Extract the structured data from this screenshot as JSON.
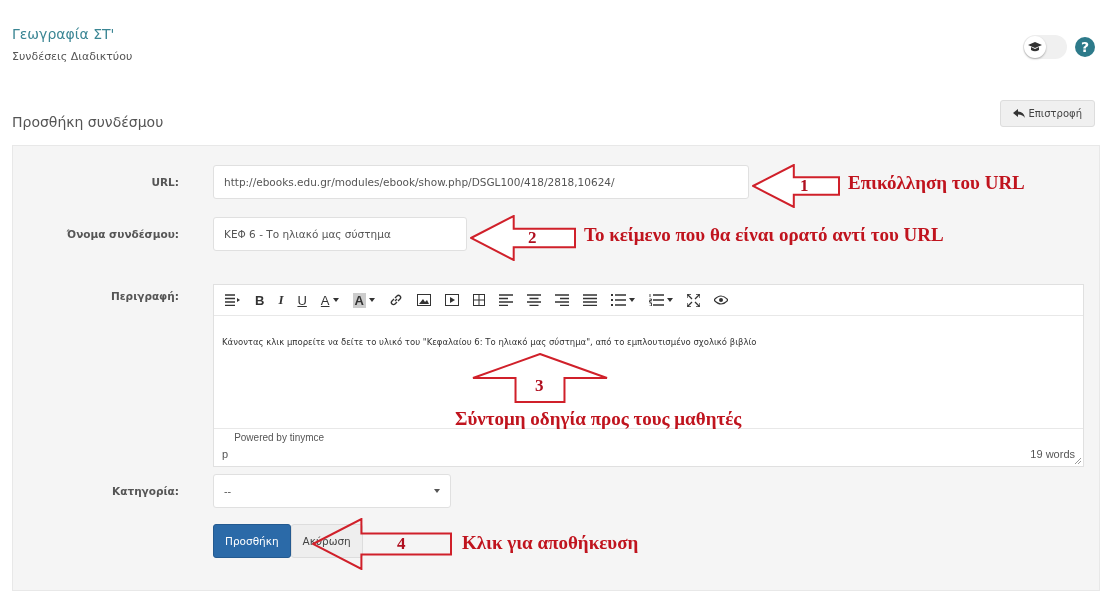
{
  "header": {
    "course_title": "Γεωγραφία ΣΤ'",
    "module": "Συνδέσεις Διαδικτύου",
    "student_view_toggle": {
      "on": false
    },
    "help": "?"
  },
  "page_title": "Προσθήκη συνδέσμου",
  "back_button": "Επιστροφή",
  "form": {
    "url": {
      "label": "URL:",
      "value": "http://ebooks.edu.gr/modules/ebook/show.php/DSGL100/418/2818,10624/"
    },
    "link_name": {
      "label": "Όνομα συνδέσμου:",
      "value": "ΚΕΦ 6 - Το ηλιακό μας σύστημα"
    },
    "description": {
      "label": "Περιγραφή:",
      "toolbar": [
        {
          "kind": "format"
        },
        {
          "kind": "bold",
          "label": "B"
        },
        {
          "kind": "italic",
          "label": "I"
        },
        {
          "kind": "underline",
          "label": "U"
        },
        {
          "kind": "text-color",
          "label": "A"
        },
        {
          "kind": "highlight",
          "label": "A"
        },
        {
          "kind": "link"
        },
        {
          "kind": "image"
        },
        {
          "kind": "media"
        },
        {
          "kind": "table"
        },
        {
          "kind": "align-left"
        },
        {
          "kind": "align-center"
        },
        {
          "kind": "align-right"
        },
        {
          "kind": "justify"
        },
        {
          "kind": "bullets"
        },
        {
          "kind": "numbers"
        },
        {
          "kind": "fullscreen"
        },
        {
          "kind": "preview"
        }
      ],
      "content": "Κάνοντας κλικ μπορείτε να δείτε το υλικό του \"Κεφαλαίου 6: Το ηλιακό μας σύστημα\", από το εμπλουτισμένο σχολικό βιβλίο",
      "path": "p",
      "powered_by": "Powered by tinymce",
      "word_count": "19 words"
    },
    "category": {
      "label": "Κατηγορία:",
      "value": "--"
    },
    "buttons": [
      {
        "kind": "primary",
        "label": "Προσθήκη"
      },
      {
        "kind": "secondary",
        "label": "Ακύρωση"
      }
    ]
  },
  "annotations": [
    {
      "kind": "left-arrow",
      "number": "1",
      "text": "Επικόλληση του URL"
    },
    {
      "kind": "left-arrow",
      "number": "2",
      "text": "Το κείμενο που θα είναι ορατό αντί του URL"
    },
    {
      "kind": "up-arrow",
      "number": "3",
      "text": "Σύντομη οδηγία προς τους μαθητές"
    },
    {
      "kind": "left-arrow",
      "number": "4",
      "text": "Κλικ για αποθήκευση"
    }
  ]
}
